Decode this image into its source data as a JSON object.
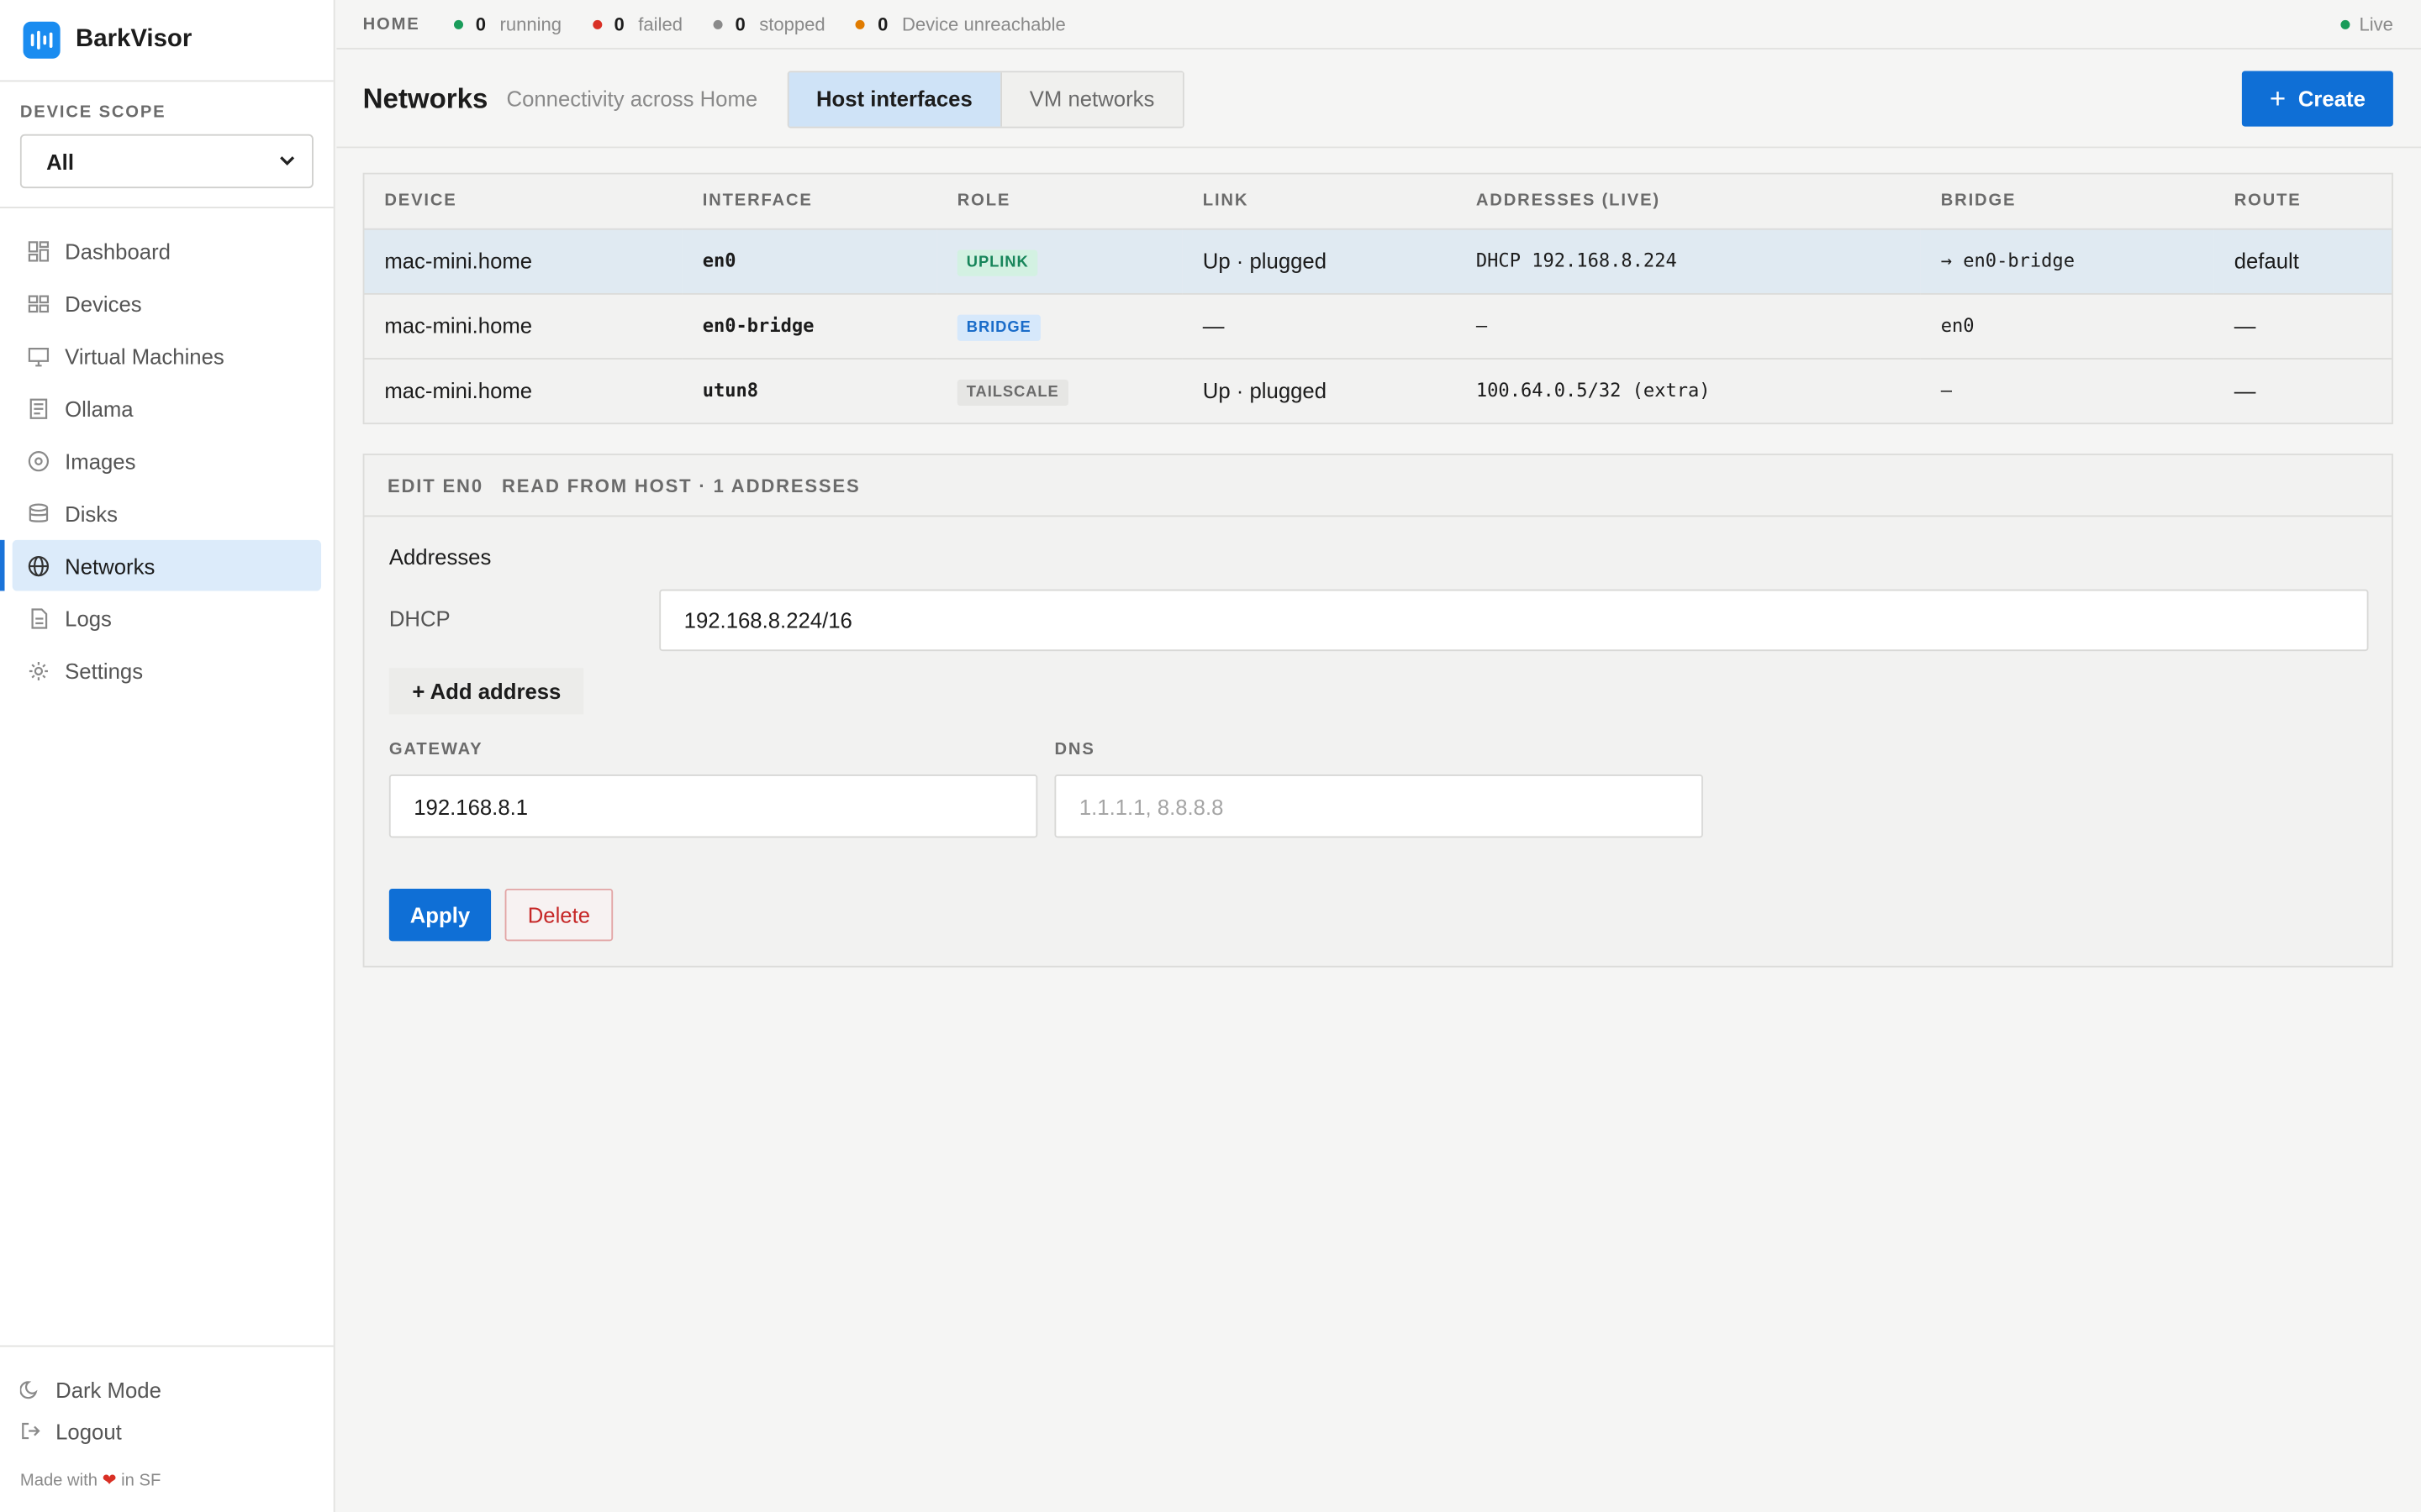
{
  "brand": {
    "name": "BarkVisor"
  },
  "scope": {
    "label": "DEVICE SCOPE",
    "value": "All"
  },
  "nav": [
    {
      "label": "Dashboard",
      "icon": "dashboard-icon"
    },
    {
      "label": "Devices",
      "icon": "devices-icon"
    },
    {
      "label": "Virtual Machines",
      "icon": "monitor-icon"
    },
    {
      "label": "Ollama",
      "icon": "document-icon"
    },
    {
      "label": "Images",
      "icon": "disc-icon"
    },
    {
      "label": "Disks",
      "icon": "database-icon"
    },
    {
      "label": "Networks",
      "icon": "globe-icon",
      "active": true
    },
    {
      "label": "Logs",
      "icon": "file-icon"
    },
    {
      "label": "Settings",
      "icon": "gear-icon"
    }
  ],
  "sidebar_bottom": {
    "dark_mode": "Dark Mode",
    "logout": "Logout",
    "made_prefix": "Made with",
    "made_suffix": "in SF"
  },
  "status": {
    "home": "HOME",
    "running_count": "0",
    "running_label": "running",
    "running_color": "#1a9c5a",
    "failed_count": "0",
    "failed_label": "failed",
    "failed_color": "#d93025",
    "stopped_count": "0",
    "stopped_label": "stopped",
    "stopped_color": "#8a8a8a",
    "unreach_count": "0",
    "unreach_label": "Device unreachable",
    "unreach_color": "#e07b00",
    "live": "Live",
    "live_color": "#1a9c5a"
  },
  "header": {
    "title": "Networks",
    "subtitle": "Connectivity across Home",
    "tabs": [
      "Host interfaces",
      "VM networks"
    ],
    "create": "Create"
  },
  "table": {
    "columns": [
      "DEVICE",
      "INTERFACE",
      "ROLE",
      "LINK",
      "ADDRESSES (LIVE)",
      "BRIDGE",
      "ROUTE"
    ],
    "rows": [
      {
        "device": "mac-mini.home",
        "interface": "en0",
        "role": "UPLINK",
        "link": "Up · plugged",
        "addresses": "DHCP 192.168.8.224",
        "bridge": "→ en0-bridge",
        "route": "default"
      },
      {
        "device": "mac-mini.home",
        "interface": "en0-bridge",
        "role": "BRIDGE",
        "link": "—",
        "addresses": "–",
        "bridge": "en0",
        "route": "—"
      },
      {
        "device": "mac-mini.home",
        "interface": "utun8",
        "role": "TAILSCALE",
        "link": "Up · plugged",
        "addresses": "100.64.0.5/32 (extra)",
        "bridge": "–",
        "route": "—"
      }
    ]
  },
  "edit": {
    "heading": "EDIT EN0",
    "meta": "READ FROM HOST · 1 ADDRESSES",
    "addresses_title": "Addresses",
    "dhcp_label": "DHCP",
    "dhcp_value": "192.168.8.224/16",
    "add_address": "+ Add address",
    "gateway_label": "GATEWAY",
    "gateway_value": "192.168.8.1",
    "dns_label": "DNS",
    "dns_placeholder": "1.1.1.1, 8.8.8.8",
    "apply": "Apply",
    "delete": "Delete"
  }
}
